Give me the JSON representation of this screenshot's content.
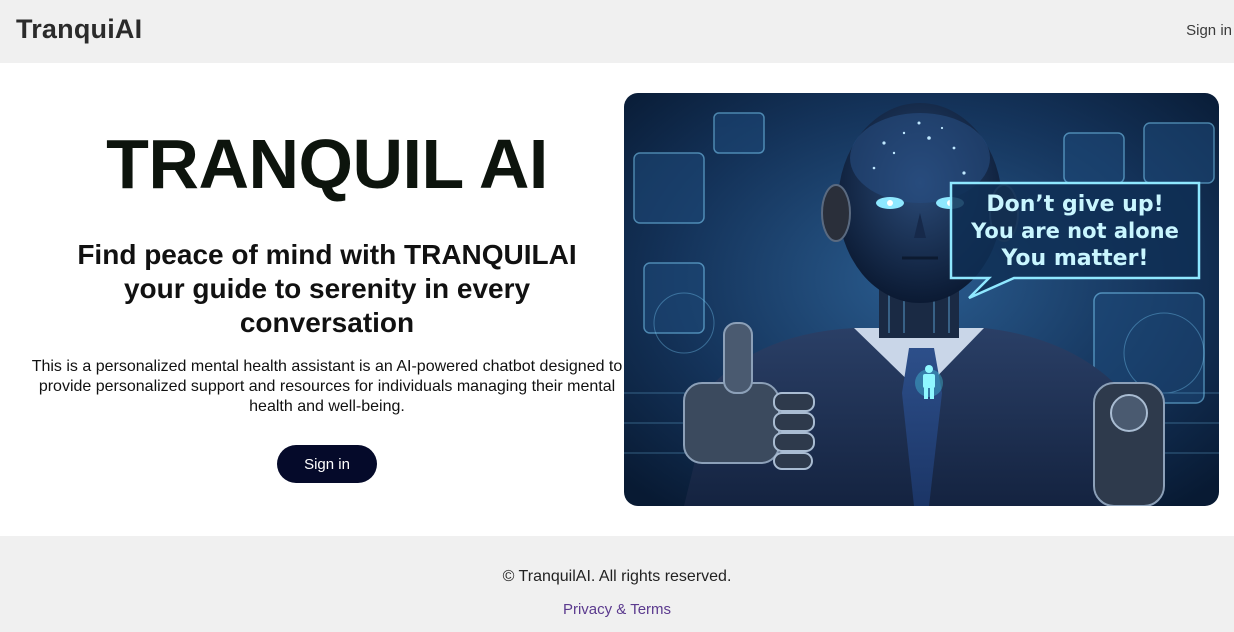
{
  "header": {
    "brand": "TranquiAI",
    "signin_label": "Sign in"
  },
  "hero": {
    "title": "TRANQUIL AI",
    "subtitle": "Find peace of mind with TRANQUILAI your guide to serenity in every conversation",
    "description": "This is a personalized mental health assistant is an AI-powered chatbot designed to provide personalized support and resources for individuals managing their mental health and well-being.",
    "cta_label": "Sign in",
    "image": {
      "speech_line1": "Don’t give up!",
      "speech_line2": "You are not alone",
      "speech_line3": "You matter!"
    }
  },
  "footer": {
    "copyright": "© TranquilAI. All rights reserved.",
    "link_label": "Privacy & Terms"
  },
  "colors": {
    "header_bg": "#f0f0f0",
    "cta_bg": "#050a2a",
    "link": "#5b3a8e"
  }
}
